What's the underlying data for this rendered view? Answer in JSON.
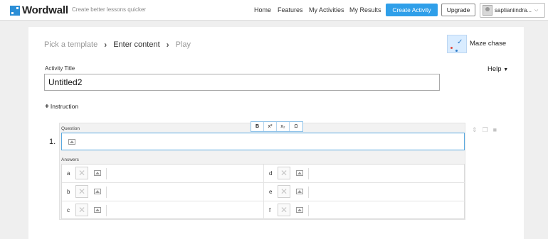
{
  "header": {
    "brand": "Wordwall",
    "tagline": "Create better lessons quicker",
    "nav": [
      "Home",
      "Features",
      "My Activities",
      "My Results"
    ],
    "create_button": "Create Activity",
    "upgrade_button": "Upgrade",
    "user_name": "saptianiindra..."
  },
  "steps": {
    "step1": "Pick a template",
    "step2": "Enter content",
    "step3": "Play"
  },
  "template": {
    "name": "Maze chase"
  },
  "help_label": "Help",
  "activity": {
    "title_label": "Activity Title",
    "title_value": "Untitled2"
  },
  "instruction_label": "Instruction",
  "question": {
    "number": "1.",
    "label": "Question",
    "toolbar": [
      "B",
      "x²",
      "x₂",
      "Ω"
    ],
    "answers_label": "Answers",
    "answers": [
      {
        "letter": "a"
      },
      {
        "letter": "b"
      },
      {
        "letter": "c"
      },
      {
        "letter": "d"
      },
      {
        "letter": "e"
      },
      {
        "letter": "f"
      }
    ]
  },
  "colors": {
    "accent": "#2f9fe9",
    "focus_border": "#5aa9e0"
  }
}
